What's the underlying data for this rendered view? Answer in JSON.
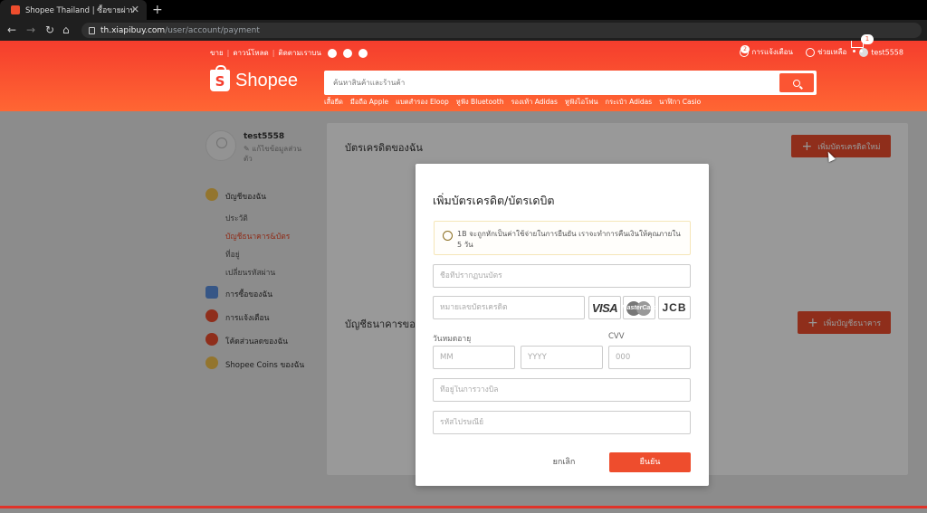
{
  "browser": {
    "tab_title": "Shopee Thailand | ซื้อขายผ่านมือถือ",
    "url_host": "th.xiapibuy.com",
    "url_path": "/user/account/payment"
  },
  "header": {
    "top_links": [
      "ขาย",
      "ดาวน์โหลด",
      "ติดตามเราบน"
    ],
    "notifications_label": "การแจ้งเตือน",
    "notifications_count": "2",
    "help_label": "ช่วยเหลือ",
    "username": "test5558",
    "logo_text": "Shopee",
    "search_placeholder": "ค้นหาสินค้าและร้านค้า",
    "suggestions": [
      "เสื้อยืด",
      "มือถือ Apple",
      "แบตสำรอง Eloop",
      "หูฟัง Bluetooth",
      "รองเท้า Adidas",
      "หูฟังไอโฟน",
      "กระเป๋า Adidas",
      "นาฬิกา Casio"
    ],
    "cart_count": "1"
  },
  "sidebar": {
    "username": "test5558",
    "edit_profile": "แก้ไขข้อมูลส่วนตัว",
    "my_account": "บัญชีของฉัน",
    "sub_items": [
      "ประวัติ",
      "บัญชีธนาคาร&บัตร",
      "ที่อยู่",
      "เปลี่ยนรหัสผ่าน"
    ],
    "my_purchases": "การซื้อของฉัน",
    "notifications": "การแจ้งเตือน",
    "vouchers": "โค้ดส่วนลดของฉัน",
    "coins": "Shopee Coins ของฉัน"
  },
  "main": {
    "credit_heading": "บัตรเครดิตของฉัน",
    "add_card_button": "เพิ่มบัตรเครดิตใหม่",
    "bank_heading": "บัญชีธนาคารของฉัน",
    "add_bank_button": "เพิ่มบัญชีธนาคาร"
  },
  "modal": {
    "title": "เพิ่มบัตรเครดิต/บัตรเดบิต",
    "notice": "1B จะถูกหักเป็นค่าใช้จ่ายในการยืนยัน เราจะทำการคืนเงินให้คุณภายใน 5 วัน",
    "cardholder_placeholder": "ชื่อที่ปรากฏบนบัตร",
    "card_number_placeholder": "หมายเลขบัตรเครดิต",
    "card_logos": [
      "VISA",
      "MasterCard",
      "JCB"
    ],
    "expiry_label": "วันหมดอายุ",
    "month_placeholder": "MM",
    "year_placeholder": "YYYY",
    "cvv_label": "CVV",
    "cvv_placeholder": "000",
    "billing_address_placeholder": "ที่อยู่ในการวางบิล",
    "postal_code_placeholder": "รหัสไปรษณีย์",
    "cancel_button": "ยกเลิก",
    "confirm_button": "ยืนยัน"
  },
  "colors": {
    "brand": "#ee4d2d",
    "header_gradient_top": "#f53d2d",
    "header_gradient_bottom": "#ff6633"
  }
}
